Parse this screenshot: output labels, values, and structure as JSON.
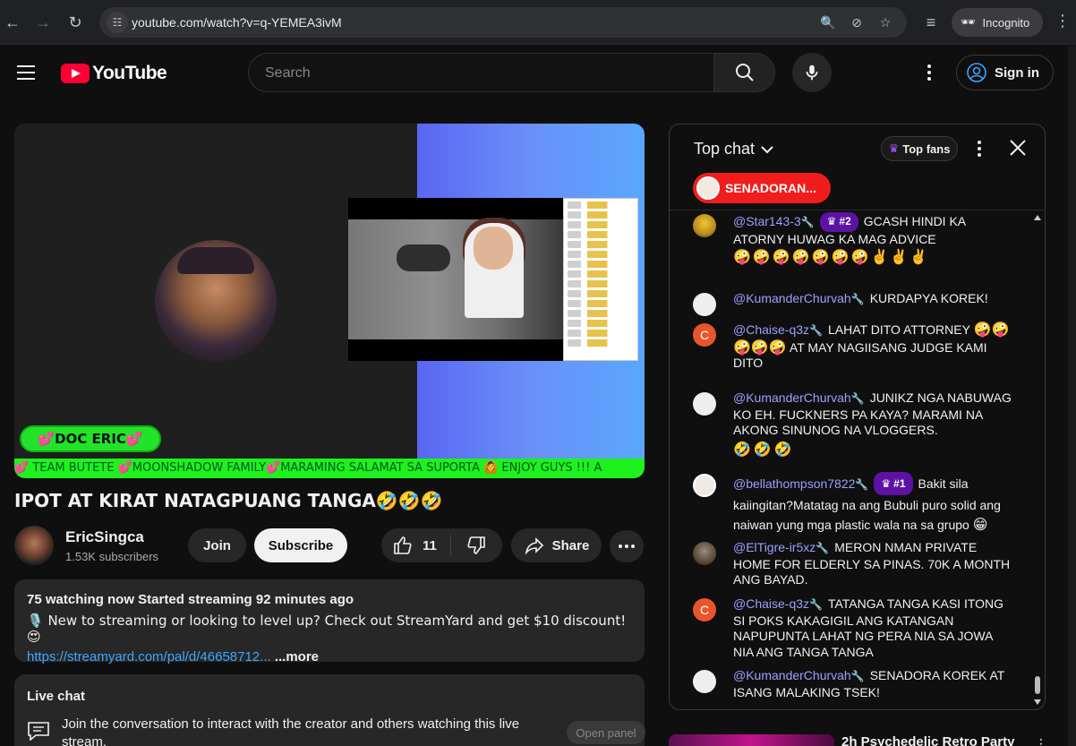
{
  "browser": {
    "url": "youtube.com/watch?v=q-YEMEA3ivM",
    "incognito_label": "Incognito"
  },
  "masthead": {
    "logo_text": "YouTube",
    "search_placeholder": "Search",
    "sign_in_label": "Sign in"
  },
  "player": {
    "doc_badge": "💕DOC ERIC💕",
    "ticker_text": "💕 TEAM BUTETE 💕MOONSHADOW FAMILY💕MARAMING SALAMAT SA SUPORTA 🙆 ENJOY GUYS !!! A"
  },
  "video": {
    "title": "IPOT AT KIRAT NATAGPUANG TANGA🤣🤣🤣",
    "channel_name": "EricSingca",
    "subscribers": "1.53K subscribers",
    "join_label": "Join",
    "subscribe_label": "Subscribe",
    "like_count": "11",
    "share_label": "Share"
  },
  "description": {
    "stats": "75 watching now  Started streaming 92 minutes ago",
    "line1": "🎙️ New to streaming or looking to level up? Check out StreamYard and get $10 discount! 😍",
    "link": "https://streamyard.com/pal/d/46658712...",
    "more_label": " ...more"
  },
  "live_chat_card": {
    "title": "Live chat",
    "text": "Join the conversation to interact with the creator and others watching this live stream.",
    "open_label": "Open panel"
  },
  "chat": {
    "title": "Top chat",
    "top_fans_label": "Top fans",
    "pinned_label": "SENADORAN...",
    "messages": [
      {
        "author": "@Star143-3",
        "rank": "#2",
        "text": "GCASH HINDI KA ATORNY HUWAG KA MAG ADVICE",
        "emoji": "🤪🤪🤪🤪🤪🤪🤪✌️✌️✌️"
      },
      {
        "author": "@KumanderChurvah",
        "rank": "",
        "text": "KURDAPYA KOREK!",
        "emoji": ""
      },
      {
        "author": "@Chaise-q3z",
        "rank": "",
        "text": "LAHAT DITO ATTORNEY",
        "emoji": "🤪🤪🤪🤪🤪",
        "text2": "AT MAY NAGIISANG JUDGE KAMI DITO"
      },
      {
        "author": "@KumanderChurvah",
        "rank": "",
        "text": "JUNIKZ NGA NABUWAG KO EH. FUCKNERS PA KAYA? MARAMI NA AKONG SINUNOG NA VLOGGERS.",
        "emoji": "🤣🤣🤣"
      },
      {
        "author": "@bellathompson7822",
        "rank": "#1",
        "text": "Bakit sila kaiingitan?Matatag na ang Bubuli puro solid ang naiwan yung mga plastic wala na sa grupo",
        "emoji": "😁"
      },
      {
        "author": "@ElTigre-ir5xz",
        "rank": "",
        "text": "MERON NMAN PRIVATE HOME FOR ELDERLY SA PINAS. 70K A MONTH ANG BAYAD.",
        "emoji": ""
      },
      {
        "author": "@Chaise-q3z",
        "rank": "",
        "text": "TATANGA TANGA KASI ITONG SI POKS KAKAGIGIL ANG KATANGAN NAPUPUNTA LAHAT NG PERA NIA SA JOWA NIA ANG TANGA TANGA",
        "emoji": ""
      },
      {
        "author": "@KumanderChurvah",
        "rank": "",
        "text": "SENADORA KOREK AT ISANG MALAKING TSEK!",
        "emoji": ""
      }
    ],
    "avatar_letter": "C"
  },
  "up_next": {
    "title": "2h Psychedelic Retro Party"
  },
  "colors": {
    "accent_red": "#ff0033",
    "author_blue": "#9aa0ff",
    "rank_purple": "#5c12a3",
    "ticker_green": "#1df21d"
  }
}
